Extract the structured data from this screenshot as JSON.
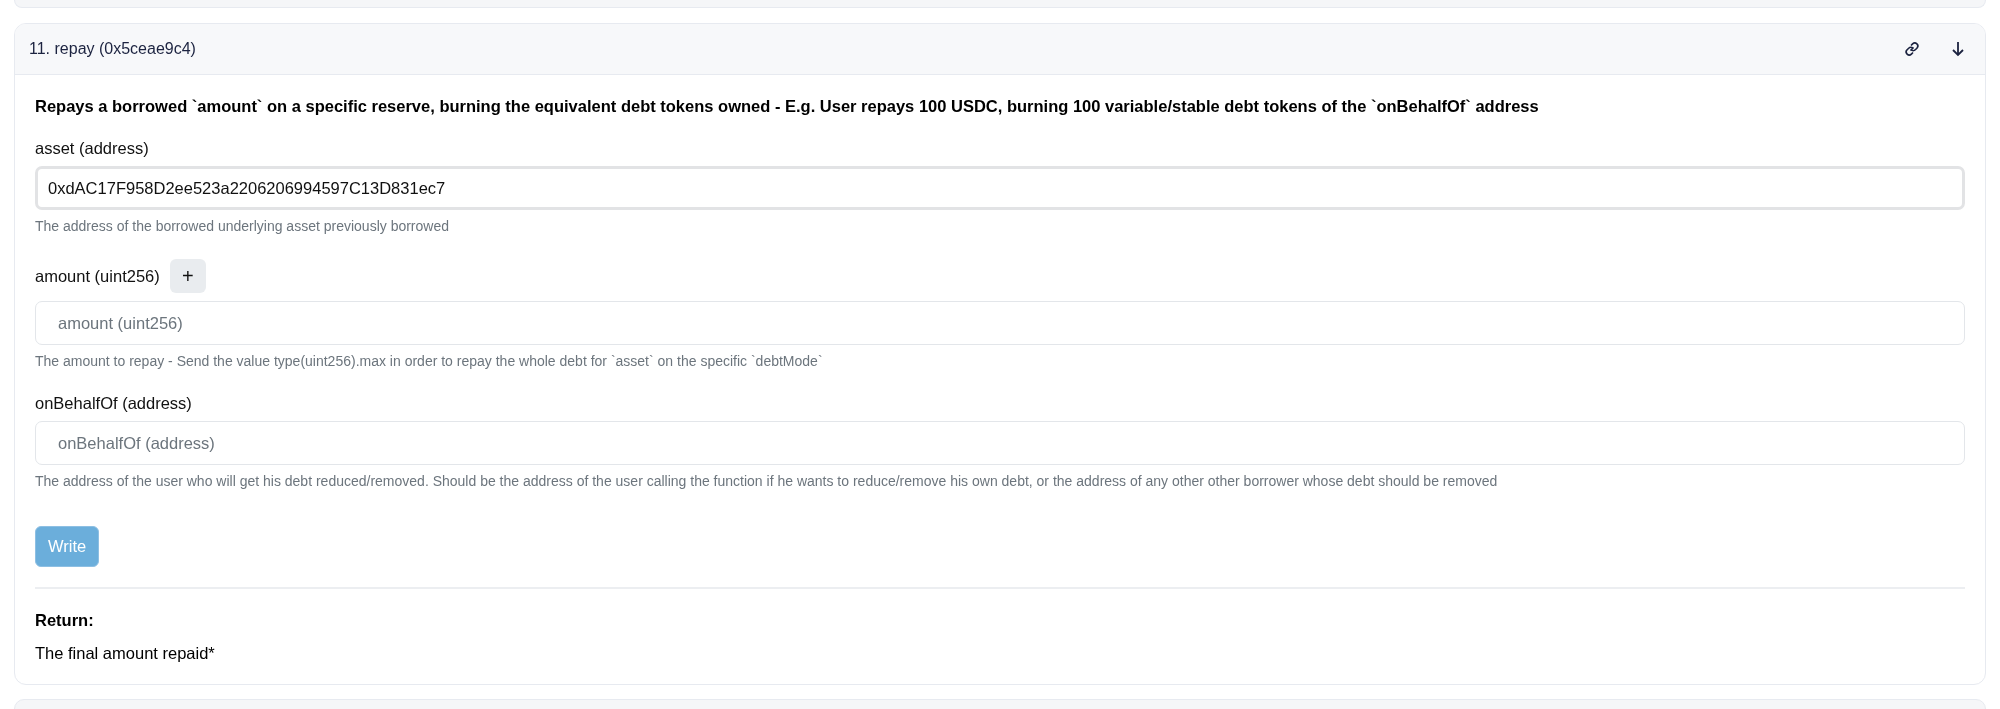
{
  "function_card": {
    "title": "11. repay (0x5ceae9c4)",
    "expanded": true,
    "description": "Repays a borrowed `amount` on a specific reserve, burning the equivalent debt tokens owned - E.g. User repays 100 USDC, burning 100 variable/stable debt tokens of the `onBehalfOf` address",
    "params": [
      {
        "label": "asset (address)",
        "value": "0xdAC17F958D2ee523a2206206994597C13D831ec7",
        "hint": "The address of the borrowed underlying asset previously borrowed",
        "focused": true
      },
      {
        "label": "amount (uint256)",
        "placeholder": "amount (uint256)",
        "hint": "The amount to repay - Send the value type(uint256).max in order to repay the whole debt for `asset` on the specific `debtMode`",
        "add_label": "+",
        "focused": false
      },
      {
        "label": "onBehalfOf (address)",
        "placeholder": "onBehalfOf (address)",
        "hint": "The address of the user who will get his debt reduced/removed. Should be the address of the user calling the function if he wants to reduce/remove his own debt, or the address of any other other borrower whose debt should be removed",
        "focused": false
      }
    ],
    "write_button": {
      "label": "Write",
      "disabled": true
    },
    "return_heading": "Return:",
    "return_text": "The final amount repaid*"
  }
}
